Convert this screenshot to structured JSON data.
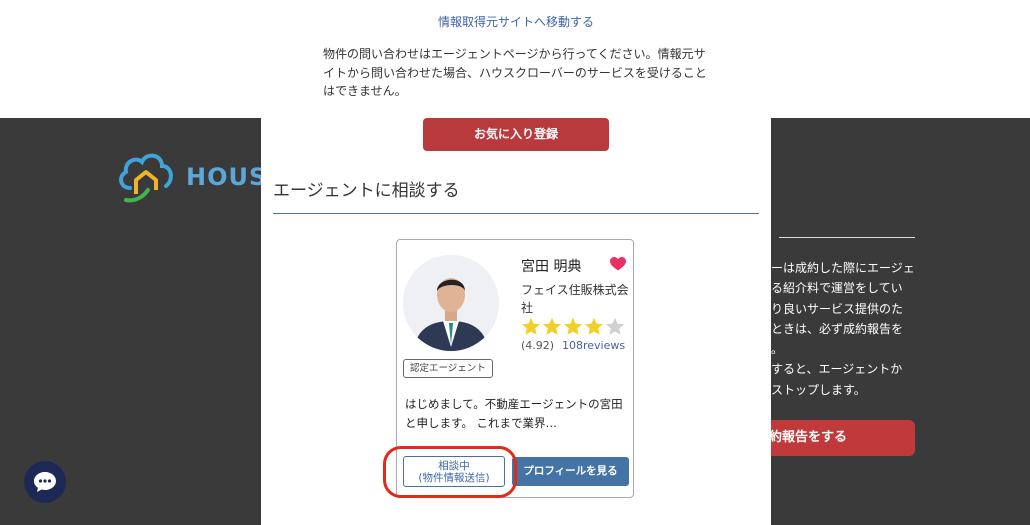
{
  "background": {
    "logo_text": "HOUS",
    "side_text": "ーは成約した際にエージェ\nる紹介料で運営をしてい\nり良いサービス提供のた\nときは、必ず成約報告を\n。\nすると、エージェントか\nストップします。",
    "report_button": "約報告をする"
  },
  "modal": {
    "source_link": "情報取得元サイトへ移動する",
    "notice": "物件の問い合わせはエージェントページから行ってください。情報元サイトから問い合わせた場合、ハウスクローバーのサービスを受けることはできません。",
    "favorite_button": "お気に入り登録",
    "section_title": "エージェントに相談する"
  },
  "agent": {
    "name": "宮田 明典",
    "company": "フェイス住販株式会社",
    "rating_text": "(4.92)",
    "rating_value": 4.92,
    "rating_max": 5,
    "reviews": "108reviews",
    "badge": "認定エージェント",
    "intro": "はじめまして。不動産エージェントの宮田と申します。 これまで業界…",
    "consult_line1": "相談中",
    "consult_line2": "(物件情報送信)",
    "profile_button": "プロフィールを見る"
  },
  "icons": {
    "favorite": "heart-icon",
    "chat": "chat-bubble-icon",
    "logo": "cloud-house-logo-icon"
  },
  "colors": {
    "accent_red": "#b83a3d",
    "link_blue": "#3d63a8",
    "profile_blue": "#4474a6",
    "star_gold": "#f2d02b",
    "star_empty": "#d0d0d0",
    "highlight_red": "#e02a1a",
    "chat_navy": "#1c2957"
  }
}
